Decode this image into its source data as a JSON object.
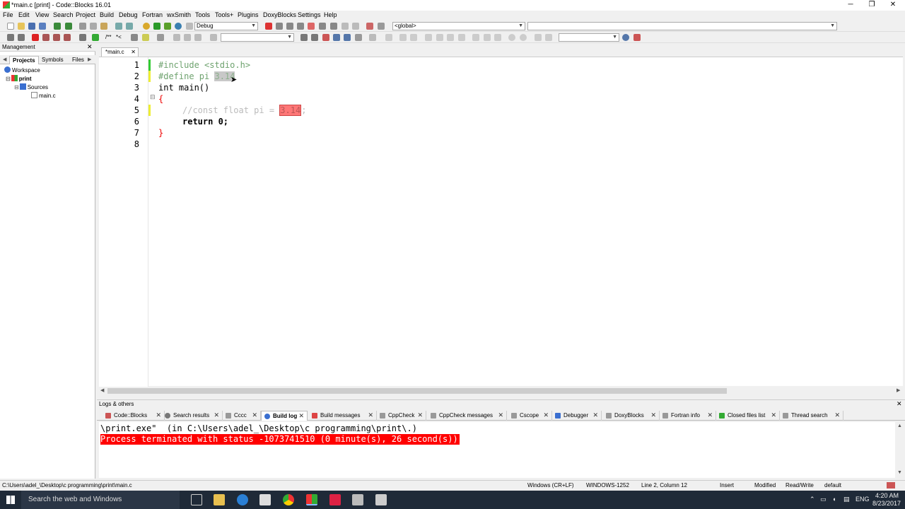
{
  "window": {
    "title": "*main.c [print] - Code::Blocks 16.01",
    "minimize": "─",
    "restore": "❐",
    "close": "✕"
  },
  "menu": [
    "File",
    "Edit",
    "View",
    "Search",
    "Project",
    "Build",
    "Debug",
    "Fortran",
    "wxSmith",
    "Tools",
    "Tools+",
    "Plugins",
    "DoxyBlocks",
    "Settings",
    "Help"
  ],
  "toolbar": {
    "build_target": "Debug",
    "scope": "<global>",
    "doxy_comment": "/**",
    "doxy_line": "*<"
  },
  "management": {
    "title": "Management",
    "close": "✕",
    "nav_left": "◀",
    "nav_right": "▶",
    "tabs": [
      "Projects",
      "Symbols",
      "Files"
    ],
    "tree": {
      "workspace": "Workspace",
      "project": "print",
      "folder": "Sources",
      "file": "main.c"
    }
  },
  "editor": {
    "tab_label": "*main.c",
    "tab_close": "✕",
    "line_numbers": [
      "1",
      "2",
      "3",
      "4",
      "5",
      "6",
      "7",
      "8"
    ],
    "fold_symbol": "⊟",
    "lines": {
      "l1": "#include <stdio.h>",
      "l2_pre": "#define pi ",
      "l2_val": "3.14",
      "l3": "int main()",
      "l4": "{",
      "l5_pre": "//const float pi = ",
      "l5_val": "3.14",
      "l5_post": ";",
      "l6": "return 0;",
      "l7": "}"
    }
  },
  "logs": {
    "title": "Logs & others",
    "close": "✕",
    "tabs": [
      "Code::Blocks",
      "Search results",
      "Cccc",
      "Build log",
      "Build messages",
      "CppCheck",
      "CppCheck messages",
      "Cscope",
      "Debugger",
      "DoxyBlocks",
      "Fortran info",
      "Closed files list",
      "Thread search"
    ],
    "tab_close": "✕",
    "line1": "\\print.exe\"  (in C:\\Users\\adel_\\Desktop\\c programming\\print\\.)",
    "line2": "Process terminated with status -1073741510 (0 minute(s), 26 second(s))"
  },
  "status": {
    "path": "C:\\Users\\adel_\\Desktop\\c programming\\print\\main.c",
    "line_endings": "Windows (CR+LF)",
    "encoding": "WINDOWS-1252",
    "position": "Line 2, Column 12",
    "mode": "Insert",
    "modified": "Modified",
    "access": "Read/Write",
    "profile": "default"
  },
  "taskbar": {
    "search_placeholder": "Search the web and Windows",
    "lang": "ENG",
    "time": "4:20 AM",
    "date": "8/23/2017"
  },
  "colors": {
    "accent_error": "#ff0000",
    "preprocessor": "#6fa36f",
    "taskbar": "#1f2a38"
  }
}
